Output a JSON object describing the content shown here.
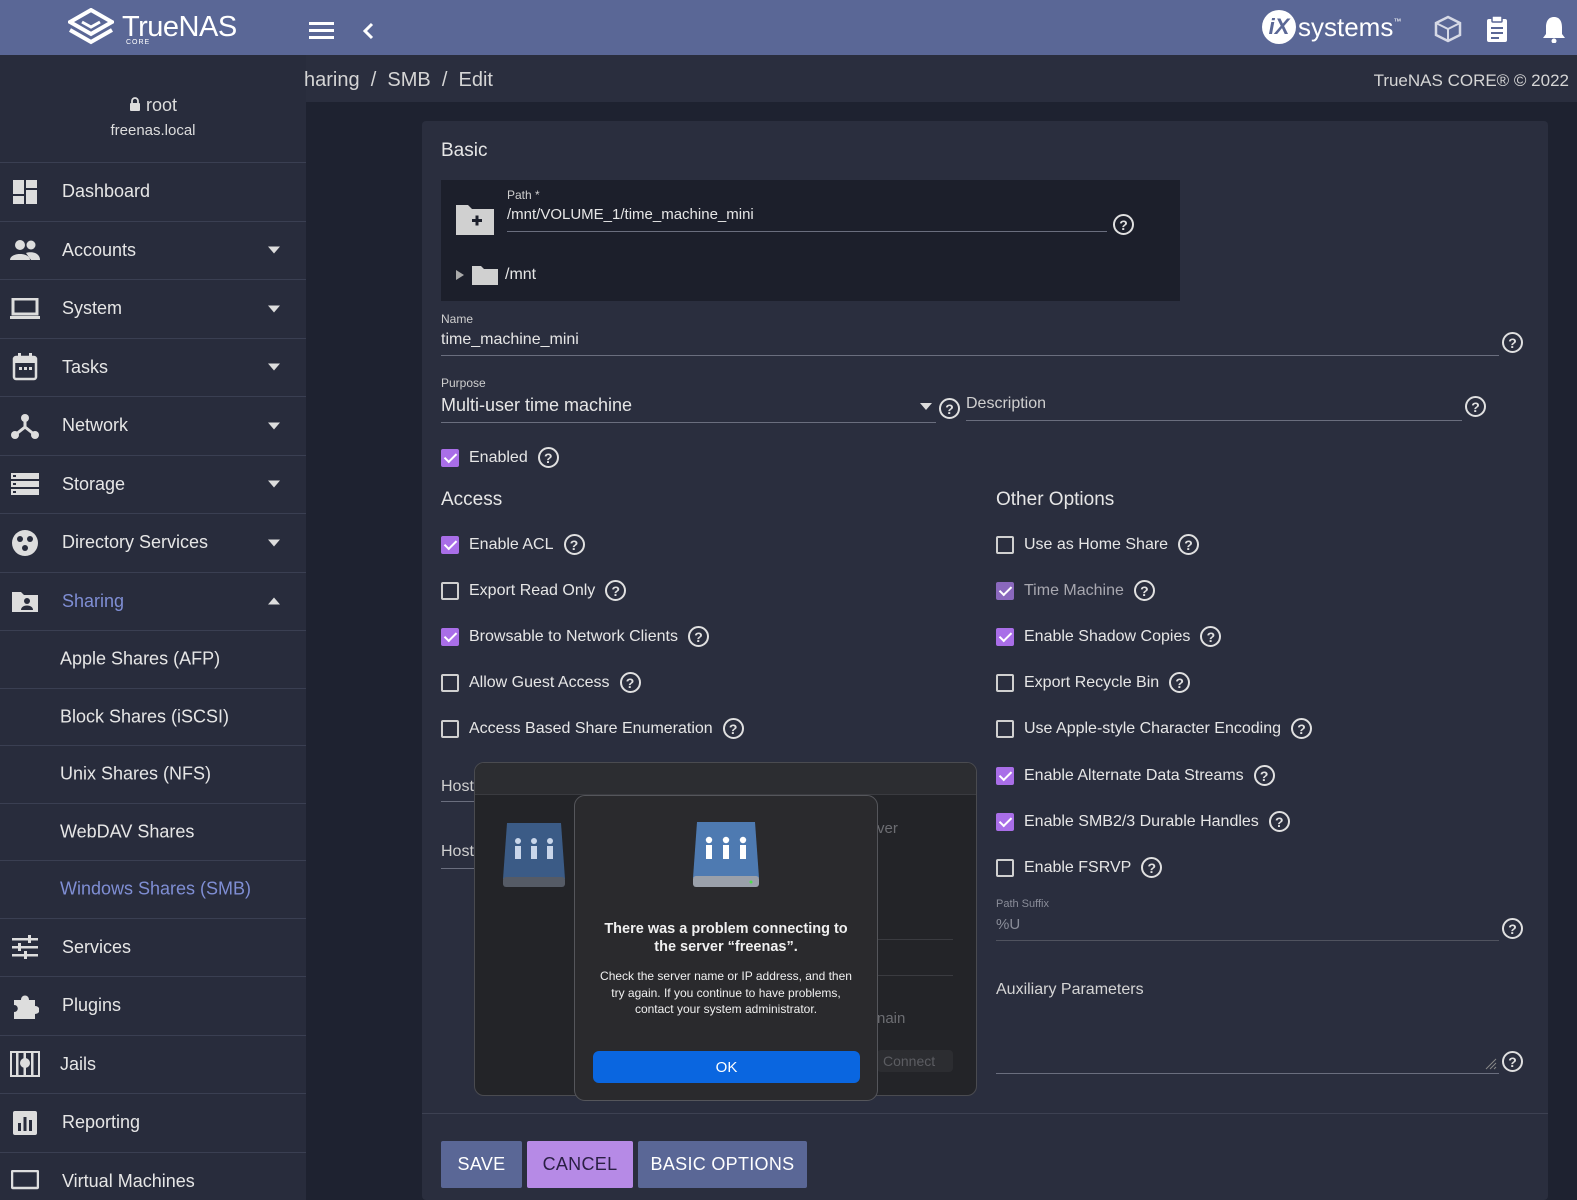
{
  "topbar": {
    "logo_name": "TrueNAS",
    "logo_edition": "CORE",
    "brand": "systems",
    "brand_mark": "iX",
    "brand_tm": "™",
    "icons": [
      "menu-icon",
      "chevron-left-icon",
      "truecommand-icon",
      "clipboard-icon",
      "bell-icon"
    ]
  },
  "user": {
    "name": "root",
    "host": "freenas.local"
  },
  "nav": {
    "items": [
      {
        "label": "Dashboard",
        "icon": "dashboard-icon"
      },
      {
        "label": "Accounts",
        "icon": "accounts-icon"
      },
      {
        "label": "System",
        "icon": "laptop-icon"
      },
      {
        "label": "Tasks",
        "icon": "calendar-icon"
      },
      {
        "label": "Network",
        "icon": "network-icon"
      },
      {
        "label": "Storage",
        "icon": "storage-icon"
      },
      {
        "label": "Directory Services",
        "icon": "directory-services-icon"
      },
      {
        "label": "Sharing",
        "icon": "folder-shared-icon"
      }
    ],
    "sharing_sub": [
      {
        "label": "Apple Shares (AFP)"
      },
      {
        "label": "Block Shares (iSCSI)"
      },
      {
        "label": "Unix Shares (NFS)"
      },
      {
        "label": "WebDAV Shares"
      },
      {
        "label": "Windows Shares (SMB)"
      }
    ],
    "bottom_items": [
      {
        "label": "Services",
        "icon": "tune-icon"
      },
      {
        "label": "Plugins",
        "icon": "puzzle-icon"
      },
      {
        "label": "Jails",
        "icon": "jail-icon"
      },
      {
        "label": "Reporting",
        "icon": "chart-icon"
      },
      {
        "label": "Virtual Machines",
        "icon": "monitor-icon"
      }
    ]
  },
  "breadcrumb": {
    "path": "haring  /  SMB  /  Edit",
    "copyright": "TrueNAS CORE® © 2022"
  },
  "form": {
    "section_basic": "Basic",
    "path_label": "Path *",
    "path_value": "/mnt/VOLUME_1/time_machine_mini",
    "tree_root": "/mnt",
    "name_label": "Name",
    "name_value": "time_machine_mini",
    "purpose_label": "Purpose",
    "purpose_value": "Multi-user time machine",
    "description_label": "Description",
    "enabled_label": "Enabled",
    "section_access": "Access",
    "section_other": "Other Options",
    "access_options": [
      {
        "label": "Enable ACL",
        "checked": true
      },
      {
        "label": "Export Read Only",
        "checked": false
      },
      {
        "label": "Browsable to Network Clients",
        "checked": true
      },
      {
        "label": "Allow Guest Access",
        "checked": false
      },
      {
        "label": "Access Based Share Enumeration",
        "checked": false
      }
    ],
    "hosts_allow_label": "Host",
    "hosts_deny_label": "Host",
    "other_options": [
      {
        "label": "Use as Home Share",
        "checked": false
      },
      {
        "label": "Time Machine",
        "checked": true,
        "disabled": true
      },
      {
        "label": "Enable Shadow Copies",
        "checked": true
      },
      {
        "label": "Export Recycle Bin",
        "checked": false
      },
      {
        "label": "Use Apple-style Character Encoding",
        "checked": false
      },
      {
        "label": "Enable Alternate Data Streams",
        "checked": true
      },
      {
        "label": "Enable SMB2/3 Durable Handles",
        "checked": true
      },
      {
        "label": "Enable FSRVP",
        "checked": false
      }
    ],
    "path_suffix_label": "Path Suffix",
    "path_suffix_value": "%U",
    "aux_label": "Auxiliary Parameters"
  },
  "buttons": {
    "save": "SAVE",
    "cancel": "CANCEL",
    "basic_options": "BASIC OPTIONS"
  },
  "colors": {
    "topbar": "#5a6796",
    "accent": "#7f8ed4",
    "checkbox": "#a96ee8",
    "save": "#5a6796",
    "cancel": "#b68ae6"
  },
  "mac_dialog": {
    "title": "There was a problem connecting to the server “freenas”.",
    "message": "Check the server name or IP address, and then try again. If you continue to have problems, contact your system administrator.",
    "ok": "OK",
    "ghost_1": "ver",
    "ghost_2": "nain",
    "ghost_connect": "Connect"
  }
}
